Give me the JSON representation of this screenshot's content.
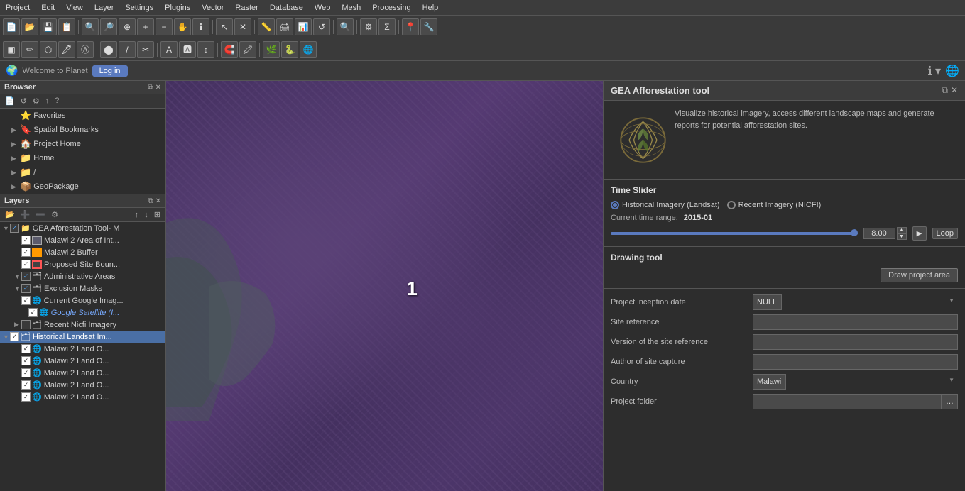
{
  "menubar": {
    "items": [
      "Project",
      "Edit",
      "View",
      "Layer",
      "Settings",
      "Plugins",
      "Vector",
      "Raster",
      "Database",
      "Web",
      "Mesh",
      "Processing",
      "Help"
    ]
  },
  "browser": {
    "title": "Browser",
    "items": [
      {
        "label": "Favorites",
        "icon": "⭐",
        "indent": 1,
        "arrow": ""
      },
      {
        "label": "Spatial Bookmarks",
        "icon": "🔖",
        "indent": 1,
        "arrow": "▶"
      },
      {
        "label": "Project Home",
        "icon": "🏠",
        "indent": 1,
        "arrow": "▶"
      },
      {
        "label": "Home",
        "icon": "📁",
        "indent": 1,
        "arrow": "▶"
      },
      {
        "label": "/",
        "icon": "📁",
        "indent": 1,
        "arrow": "▶"
      },
      {
        "label": "GeoPackage",
        "icon": "📦",
        "indent": 1,
        "arrow": "▶"
      }
    ]
  },
  "layers": {
    "title": "Layers",
    "items": [
      {
        "label": "GEA Aforestation Tool- M",
        "indent": 0,
        "checked": true,
        "arrow": "▼",
        "icon": "📁",
        "group": true
      },
      {
        "label": "Malawi 2 Area of Int...",
        "indent": 1,
        "checked": true,
        "arrow": "",
        "icon": "□",
        "color": "#fff"
      },
      {
        "label": "Malawi 2 Buffer",
        "indent": 1,
        "checked": true,
        "arrow": "",
        "icon": "□",
        "color": "#f90"
      },
      {
        "label": "Proposed Site Boun...",
        "indent": 1,
        "checked": true,
        "arrow": "",
        "icon": "□",
        "color": "#f00"
      },
      {
        "label": "Administrative Areas",
        "indent": 1,
        "checked": true,
        "arrow": "▼",
        "icon": "🗂",
        "group": true
      },
      {
        "label": "Exclusion Masks",
        "indent": 1,
        "checked": true,
        "arrow": "▼",
        "icon": "🗂",
        "group": true
      },
      {
        "label": "Current Google Imag...",
        "indent": 1,
        "checked": true,
        "arrow": "",
        "icon": "🌐"
      },
      {
        "label": "Google Satellite (I...",
        "indent": 2,
        "checked": true,
        "arrow": "",
        "icon": "🌐",
        "italic": true
      },
      {
        "label": "Recent Nicfi Imagery",
        "indent": 1,
        "checked": false,
        "arrow": "▶",
        "icon": "🗂"
      },
      {
        "label": "Historical Landsat Im...",
        "indent": 0,
        "checked": true,
        "arrow": "",
        "icon": "🗂",
        "selected": true
      },
      {
        "label": "Malawi 2 Land O...",
        "indent": 1,
        "checked": true,
        "arrow": "",
        "icon": "🌐"
      },
      {
        "label": "Malawi 2 Land O...",
        "indent": 1,
        "checked": true,
        "arrow": "",
        "icon": "🌐"
      },
      {
        "label": "Malawi 2 Land O...",
        "indent": 1,
        "checked": true,
        "arrow": "",
        "icon": "🌐"
      },
      {
        "label": "Malawi 2 Land O...",
        "indent": 1,
        "checked": true,
        "arrow": "",
        "icon": "🌐"
      },
      {
        "label": "Malawi 2 Land O...",
        "indent": 1,
        "checked": true,
        "arrow": "",
        "icon": "🌐"
      }
    ]
  },
  "map": {
    "number": "1"
  },
  "planet": {
    "welcome": "Welcome to Planet",
    "login": "Log in",
    "info_icon": "ℹ"
  },
  "right_panel": {
    "title": "GEA Afforestation tool",
    "description": "Visualize historical imagery, access different landscape maps and generate reports for potential afforestation sites.",
    "time_slider": {
      "title": "Time Slider",
      "options": [
        "Historical Imagery (Landsat)",
        "Recent Imagery (NICFI)"
      ],
      "selected": "Historical Imagery (Landsat)",
      "current_time_label": "Current time range:",
      "current_time_value": "2015-01",
      "time_number": "8.00",
      "play_label": "▶",
      "loop_label": "Loop"
    },
    "drawing_tool": {
      "title": "Drawing tool",
      "draw_button": "Draw project area"
    },
    "form": {
      "project_inception_date": {
        "label": "Project inception date",
        "value": "NULL"
      },
      "site_reference": {
        "label": "Site reference",
        "value": ""
      },
      "version_of_site_reference": {
        "label": "Version of the site reference",
        "value": ""
      },
      "author_of_site_capture": {
        "label": "Author of site capture",
        "value": ""
      },
      "country": {
        "label": "Country",
        "value": "Malawi"
      },
      "project_folder": {
        "label": "Project folder",
        "value": ""
      }
    }
  }
}
